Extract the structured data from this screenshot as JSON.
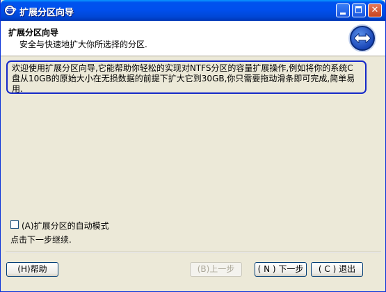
{
  "window": {
    "title": "扩展分区向导"
  },
  "header": {
    "title": "扩展分区向导",
    "subtitle": "安全与快速地扩大你所选择的分区."
  },
  "intro": {
    "text": "欢迎使用扩展分区向导,它能帮助你轻松的实现对NTFS分区的容量扩展操作,例如将你的系统C盘从10GB的原始大小在无损数据的前提下扩大它到30GB,你只需要拖动滑条即可完成,简单易用."
  },
  "options": {
    "auto_mode_label": "(A)扩展分区的自动模式",
    "auto_mode_checked": false,
    "next_hint": "点击下一步继续."
  },
  "buttons": {
    "help": "(H)帮助",
    "back": "(B)上一步",
    "next": "( N ) 下一步",
    "exit": "( C ) 退出"
  },
  "icons": {
    "title": "partition-wizard-icon",
    "header": "extend-arrows-icon"
  }
}
